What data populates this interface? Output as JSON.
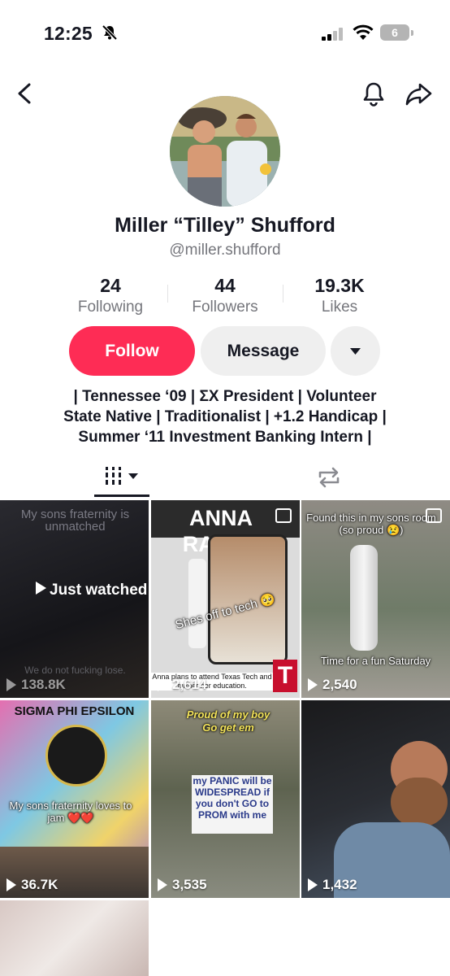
{
  "status_bar": {
    "time": "12:25",
    "battery": "6"
  },
  "profile": {
    "display_name": "Miller “Tilley” Shufford",
    "username": "@miller.shufford",
    "stats": [
      {
        "value": "24",
        "label": "Following"
      },
      {
        "value": "44",
        "label": "Followers"
      },
      {
        "value": "19.3K",
        "label": "Likes"
      }
    ],
    "bio": [
      "| Tennessee ‘09 | ΣX President | Volunteer",
      "State Native | Traditionalist | +1.2 Handicap |",
      "Summer ‘11 Investment Banking Intern |"
    ]
  },
  "actions": {
    "follow": "Follow",
    "message": "Message"
  },
  "tabs": [
    {
      "icon": "grid-icon"
    },
    {
      "icon": "repost-icon"
    }
  ],
  "videos": [
    {
      "views": "138.8K",
      "captions": [
        "My sons fraternity is unmatched"
      ],
      "overlay": "Just watched",
      "bottom_text": "We do not fucking lose."
    },
    {
      "views": "2,614",
      "captions": [
        "ANNA RAPER",
        "Shes off to tech 🥺",
        "Anna plans to attend Texas Tech and further her education."
      ]
    },
    {
      "views": "2,540",
      "captions": [
        "Found this in my sons room (so proud 😢)",
        "Time for a fun Saturday"
      ]
    },
    {
      "views": "36.7K",
      "captions": [
        "SIGMA PHI EPSILON",
        "My sons fraternity loves to jam ❤️❤️"
      ]
    },
    {
      "views": "3,535",
      "captions": [
        "Proud of my boy",
        "Go get em",
        "my PANIC will be WIDESPREAD if you don't GO to PROM with me"
      ]
    },
    {
      "views": "1,432",
      "captions": []
    },
    {
      "views": "",
      "captions": []
    }
  ]
}
